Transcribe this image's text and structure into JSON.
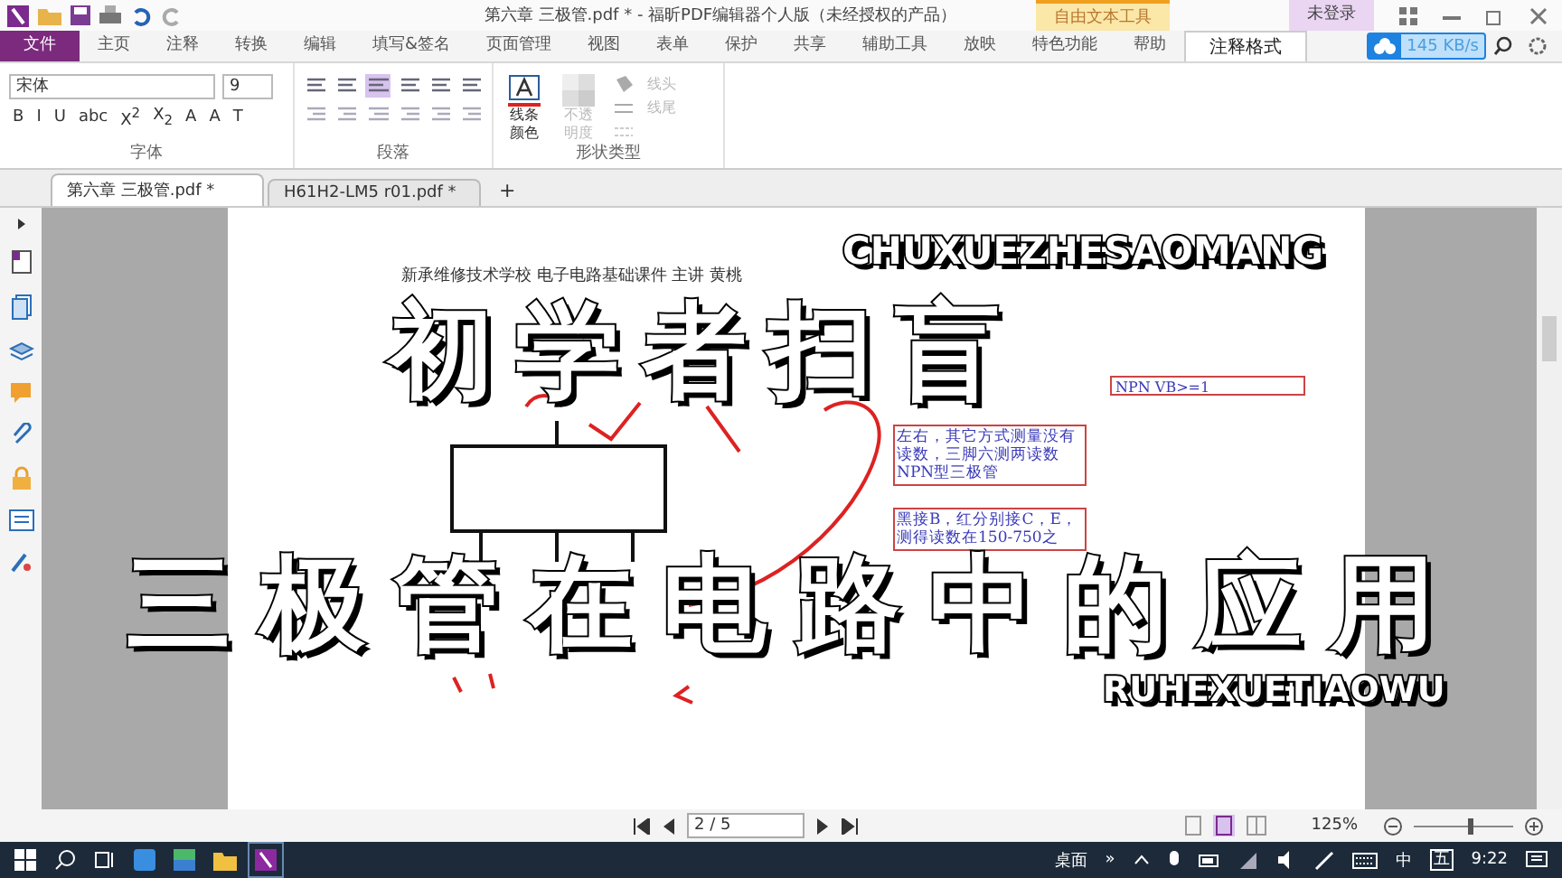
{
  "title_bar": {
    "title": "第六章 三极管.pdf * - 福昕PDF编辑器个人版（未经授权的产品）",
    "context_tab": "自由文本工具",
    "login": "未登录"
  },
  "menu_tabs": [
    {
      "label": "文件",
      "kind": "file",
      "selected": false
    },
    {
      "label": "主页",
      "kind": "tab",
      "selected": false
    },
    {
      "label": "注释",
      "kind": "tab",
      "selected": false
    },
    {
      "label": "转换",
      "kind": "tab",
      "selected": false
    },
    {
      "label": "编辑",
      "kind": "tab",
      "selected": false
    },
    {
      "label": "填写&签名",
      "kind": "tab",
      "selected": false
    },
    {
      "label": "页面管理",
      "kind": "tab",
      "selected": false
    },
    {
      "label": "视图",
      "kind": "tab",
      "selected": false
    },
    {
      "label": "表单",
      "kind": "tab",
      "selected": false
    },
    {
      "label": "保护",
      "kind": "tab",
      "selected": false
    },
    {
      "label": "共享",
      "kind": "tab",
      "selected": false
    },
    {
      "label": "辅助工具",
      "kind": "tab",
      "selected": false
    },
    {
      "label": "放映",
      "kind": "tab",
      "selected": false
    },
    {
      "label": "特色功能",
      "kind": "tab",
      "selected": false
    },
    {
      "label": "帮助",
      "kind": "tab",
      "selected": false
    },
    {
      "label": "注释格式",
      "kind": "tab",
      "selected": true
    }
  ],
  "speed": "145 KB/s",
  "ribbon": {
    "font": {
      "name": "宋体",
      "size": "9",
      "label": "字体",
      "buttons": [
        "B",
        "I",
        "U",
        "abc",
        "X$^{2}$",
        "X$_{2}$",
        "A",
        "A",
        "T"
      ]
    },
    "paragraph": {
      "label": "段落"
    },
    "shape": {
      "label": "形状类型",
      "line_color": "线条颜色",
      "opacity": "不透明度",
      "line_start": "线头",
      "line_end": "线尾"
    }
  },
  "doc_tabs": [
    {
      "label": "第六章 三极管.pdf *",
      "selected": true
    },
    {
      "label": "H61H2-LM5 r01.pdf *",
      "selected": false
    }
  ],
  "new_tab": "+",
  "page": {
    "header": "新承维修技术学校 电子电路基础课件  主讲 黄桃",
    "notes": [
      {
        "lines": [
          "左右，其它方式测量没有",
          "读数，三脚六测两读数",
          "NPN型三极管"
        ]
      },
      {
        "lines": [
          "黑接B，红分别接C，E，",
          "测得读数在150-750之"
        ]
      }
    ],
    "input": "NPN VB>=1"
  },
  "overlay": {
    "title": "初学者扫盲",
    "title_pinyin": "CHUXUEZHESAOMANG",
    "subtitle": "三极管在电路中的应用",
    "subtitle_pinyin": "RUHEXUETIAOWU"
  },
  "status": {
    "page": "2 / 5",
    "zoom": "125%",
    "zoom_slider": {
      "level": 0.55
    }
  },
  "taskbar": {
    "desktop": "桌面",
    "more": "»",
    "ime": "中",
    "ime_mode": "五",
    "time": "9:22"
  }
}
